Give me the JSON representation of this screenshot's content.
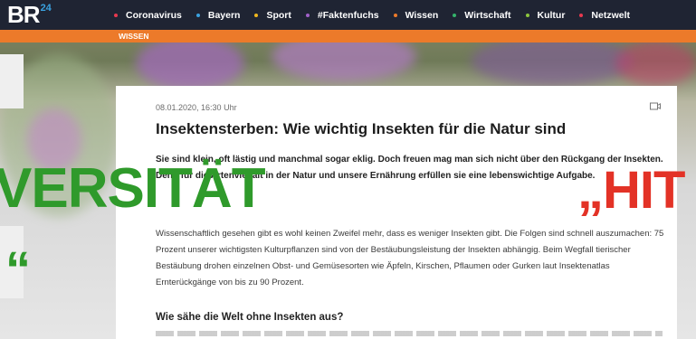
{
  "brand": {
    "logo_text": "BR",
    "logo_sup": "24"
  },
  "nav": {
    "items": [
      {
        "label": "Coronavirus",
        "color": "#e8394f"
      },
      {
        "label": "Bayern",
        "color": "#3aa2e0"
      },
      {
        "label": "Sport",
        "color": "#f0b71e"
      },
      {
        "label": "#Faktenfuchs",
        "color": "#a160c9"
      },
      {
        "label": "Wissen",
        "color": "#ec7a2a"
      },
      {
        "label": "Wirtschaft",
        "color": "#35b36b"
      },
      {
        "label": "Kultur",
        "color": "#8cc63e"
      },
      {
        "label": "Netzwelt",
        "color": "#e8394f"
      }
    ]
  },
  "section": {
    "label": "WISSEN",
    "color": "#ec7a2a"
  },
  "article": {
    "date": "08.01.2020, 16:30 Uhr",
    "title": "Insektensterben: Wie wichtig Insekten für die Natur sind",
    "lead": "Sie sind klein, oft lästig und manchmal sogar eklig. Doch freuen mag man sich nicht über den Rückgang der Insekten. Denn für die Artenvielfalt in der Natur und unsere Ernährung erfüllen sie eine lebenswichtige Aufgabe.",
    "body": "Wissenschaftlich gesehen gibt es wohl keinen Zweifel mehr, dass es weniger Insekten gibt. Die Folgen sind schnell auszumachen: 75 Prozent unserer wichtigsten Kulturpflanzen sind von der Bestäubungsleistung der Insekten abhängig. Beim Wegfall tierischer Bestäubung drohen einzelnen Obst- und Gemüsesorten wie Äpfeln, Kirschen, Pflaumen oder Gurken laut Insektenatlas Ernterückgänge von bis zu 90 Prozent.",
    "subheading": "Wie sähe die Welt ohne Insekten aus?"
  },
  "overlay": {
    "left_text": "VERSITÄT",
    "left_quote": "“",
    "right_text": "„HIT",
    "left_color": "#2f9a2b",
    "right_color": "#e33226"
  },
  "icons": {
    "camera": "video-camera-icon"
  }
}
